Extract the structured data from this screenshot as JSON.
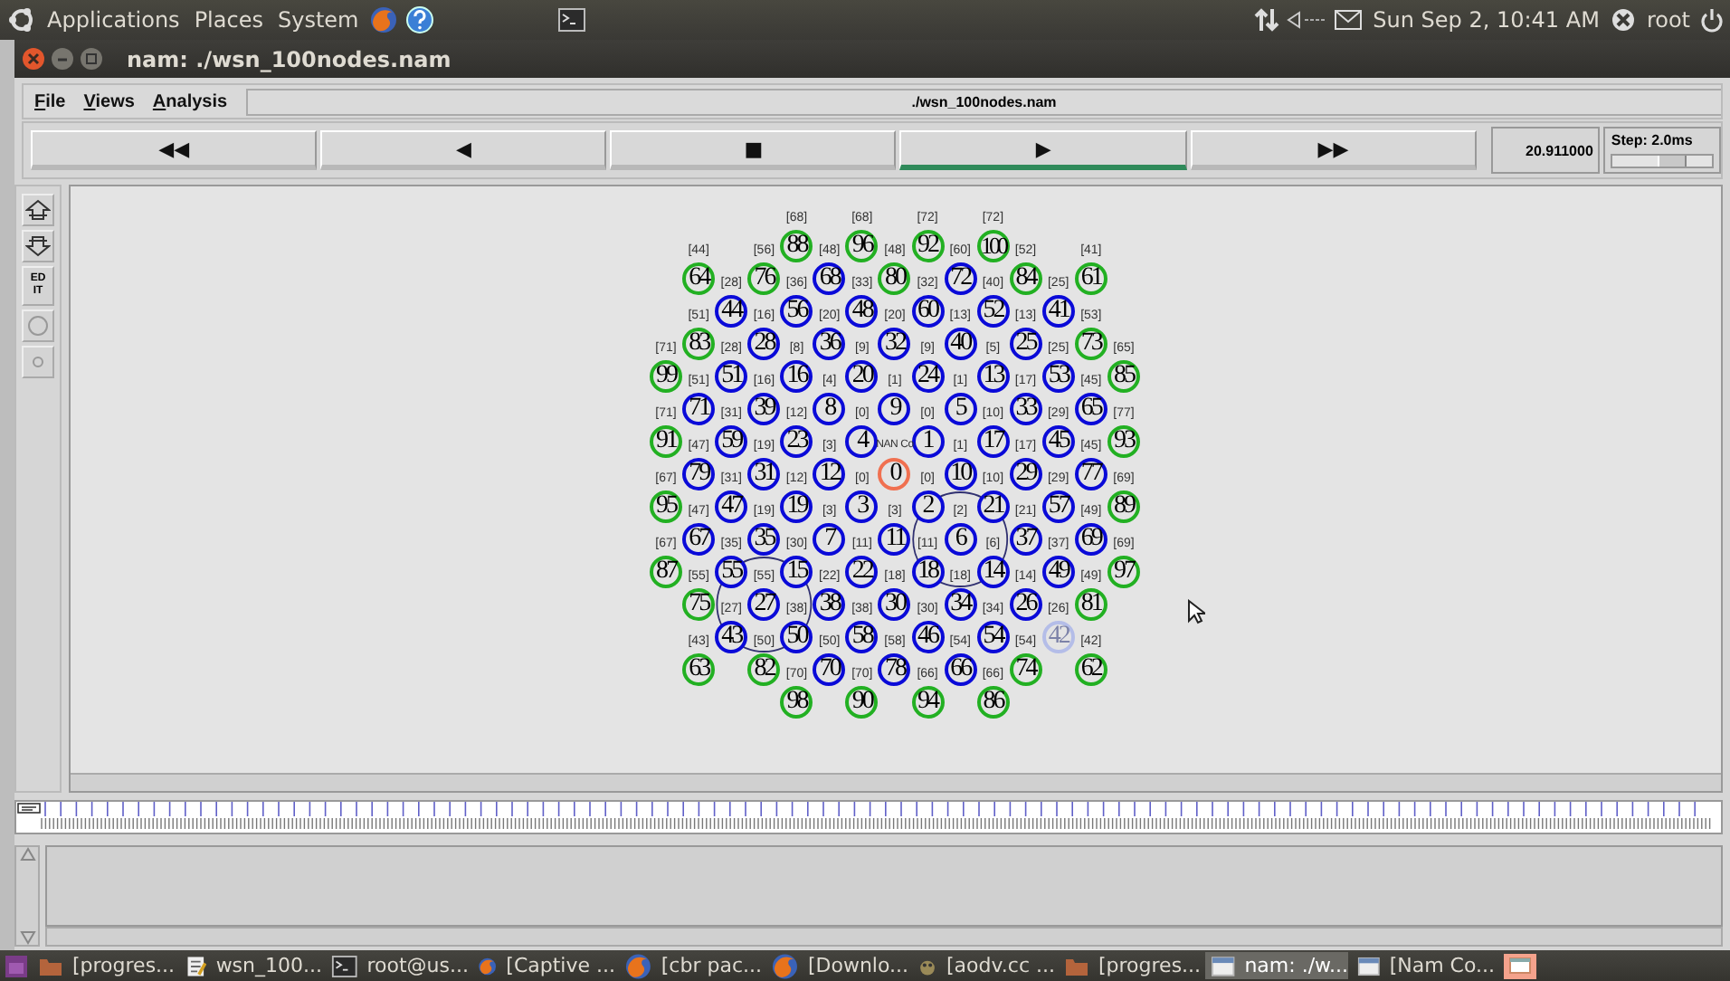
{
  "top_panel": {
    "menus": [
      "Applications",
      "Places",
      "System"
    ],
    "clock": "Sun Sep 2, 10:41 AM",
    "user": "root"
  },
  "window": {
    "title": "nam: ./wsn_100nodes.nam"
  },
  "menu": [
    "File",
    "Views",
    "Analysis"
  ],
  "file_path": "./wsn_100nodes.nam",
  "transport": [
    {
      "label": "◀◀",
      "selected": false
    },
    {
      "label": "◀",
      "selected": false
    },
    {
      "label": "■",
      "selected": false
    },
    {
      "label": "▶",
      "selected": true
    },
    {
      "label": "▶▶",
      "selected": false
    }
  ],
  "time": "20.911000",
  "step": {
    "label": "Step: 2.0ms",
    "level": 0.6
  },
  "tools": [
    {
      "kind": "zoom_in"
    },
    {
      "kind": "zoom_out"
    },
    {
      "kind": "edit",
      "label": "ED IT"
    },
    {
      "kind": "circle"
    },
    {
      "kind": "dot"
    }
  ],
  "nodes": {
    "rows": [
      [
        null,
        null,
        null,
        null,
        {
          "id": "88",
          "label": "[68]",
          "color": "#22b022",
          "kind": "plain"
        },
        null,
        {
          "id": "96",
          "label": "[68]",
          "color": "#22b022",
          "kind": "plain"
        },
        null,
        {
          "id": "92",
          "label": "[72]",
          "color": "#22b022",
          "kind": "plain"
        },
        null,
        {
          "id": "100",
          "label": "[72]",
          "color": "#22b022",
          "kind": "plain"
        },
        null,
        null,
        null,
        null
      ],
      [
        null,
        {
          "id": "64",
          "label": "[44]",
          "color": "#22b022",
          "kind": "plain"
        },
        null,
        {
          "id": "76",
          "label": "[56]",
          "color": "#22b022",
          "kind": "plain"
        },
        null,
        {
          "id": "68",
          "label": "[48]",
          "color": "#0a0ad8",
          "kind": "plain"
        },
        null,
        {
          "id": "80",
          "label": "[48]",
          "color": "#22b022",
          "kind": "plain"
        },
        null,
        {
          "id": "72",
          "label": "[60]",
          "color": "#0a0ad8",
          "kind": "plain"
        },
        null,
        {
          "id": "84",
          "label": "[52]",
          "color": "#22b022",
          "kind": "plain"
        },
        null,
        {
          "id": "61",
          "label": "[41]",
          "color": "#22b022",
          "kind": "plain"
        },
        null
      ],
      [
        null,
        null,
        {
          "id": "44",
          "label": "[28]",
          "color": "#0a0ad8",
          "kind": "plain"
        },
        null,
        {
          "id": "56",
          "label": "[36]",
          "color": "#0a0ad8",
          "kind": "plain"
        },
        null,
        {
          "id": "48",
          "label": "[33]",
          "color": "#0a0ad8",
          "kind": "plain"
        },
        null,
        {
          "id": "60",
          "label": "[32]",
          "color": "#0a0ad8",
          "kind": "plain"
        },
        null,
        {
          "id": "52",
          "label": "[40]",
          "color": "#0a0ad8",
          "kind": "plain"
        },
        null,
        {
          "id": "41",
          "label": "[25]",
          "color": "#0a0ad8",
          "kind": "plain"
        },
        null,
        null
      ],
      [
        null,
        {
          "id": "83",
          "label": "[51]",
          "color": "#22b022",
          "kind": "plain"
        },
        null,
        {
          "id": "28",
          "label": "[16]",
          "color": "#0a0ad8",
          "kind": "plain"
        },
        null,
        {
          "id": "36",
          "label": "[20]",
          "color": "#0a0ad8",
          "kind": "plain"
        },
        null,
        {
          "id": "32",
          "label": "[20]",
          "color": "#0a0ad8",
          "kind": "plain"
        },
        null,
        {
          "id": "40",
          "label": "[13]",
          "color": "#0a0ad8",
          "kind": "plain"
        },
        null,
        {
          "id": "25",
          "label": "[13]",
          "color": "#0a0ad8",
          "kind": "plain"
        },
        null,
        {
          "id": "73",
          "label": "[53]",
          "color": "#22b022",
          "kind": "plain"
        },
        null
      ],
      [
        {
          "id": "99",
          "label": "[71]",
          "color": "#22b022",
          "kind": "plain"
        },
        null,
        {
          "id": "51",
          "label": "[28]",
          "color": "#0a0ad8",
          "kind": "plain"
        },
        null,
        {
          "id": "16",
          "label": "[8]",
          "color": "#0a0ad8",
          "kind": "plain"
        },
        null,
        {
          "id": "20",
          "label": "[9]",
          "color": "#0a0ad8",
          "kind": "plain"
        },
        null,
        {
          "id": "24",
          "label": "[9]",
          "color": "#0a0ad8",
          "kind": "plain"
        },
        null,
        {
          "id": "13",
          "label": "[5]",
          "color": "#0a0ad8",
          "kind": "plain"
        },
        null,
        {
          "id": "53",
          "label": "[25]",
          "color": "#0a0ad8",
          "kind": "plain"
        },
        null,
        {
          "id": "85",
          "label": "[65]",
          "color": "#22b022",
          "kind": "plain"
        }
      ],
      [
        null,
        {
          "id": "71",
          "label": "[51]",
          "color": "#0a0ad8",
          "kind": "plain"
        },
        null,
        {
          "id": "39",
          "label": "[16]",
          "color": "#0a0ad8",
          "kind": "plain"
        },
        null,
        {
          "id": "8",
          "label": "[4]",
          "color": "#0a0ad8",
          "kind": "plain"
        },
        null,
        {
          "id": "9",
          "label": "[1]",
          "color": "#0a0ad8",
          "kind": "plain"
        },
        null,
        {
          "id": "5",
          "label": "[1]",
          "color": "#0a0ad8",
          "kind": "plain"
        },
        null,
        {
          "id": "33",
          "label": "[17]",
          "color": "#0a0ad8",
          "kind": "plain"
        },
        null,
        {
          "id": "65",
          "label": "[45]",
          "color": "#0a0ad8",
          "kind": "plain"
        },
        null
      ],
      [
        {
          "id": "91",
          "label": "[71]",
          "color": "#22b022",
          "kind": "plain"
        },
        null,
        {
          "id": "59",
          "label": "[31]",
          "color": "#0a0ad8",
          "kind": "plain"
        },
        null,
        {
          "id": "23",
          "label": "[12]",
          "color": "#0a0ad8",
          "kind": "plain"
        },
        null,
        {
          "id": "4",
          "label": "[0]",
          "color": "#0a0ad8",
          "kind": "plain"
        },
        null,
        {
          "id": "1",
          "label": "[0]",
          "color": "#0a0ad8",
          "kind": "plain"
        },
        null,
        {
          "id": "17",
          "label": "[10]",
          "color": "#0a0ad8",
          "kind": "plain"
        },
        null,
        {
          "id": "45",
          "label": "[29]",
          "color": "#0a0ad8",
          "kind": "plain"
        },
        null,
        {
          "id": "93",
          "label": "[77]",
          "color": "#22b022",
          "kind": "plain"
        }
      ],
      [
        null,
        {
          "id": "79",
          "label": "[47]",
          "color": "#0a0ad8",
          "kind": "plain"
        },
        null,
        {
          "id": "31",
          "label": "[19]",
          "color": "#0a0ad8",
          "kind": "plain"
        },
        null,
        {
          "id": "12",
          "label": "[3]",
          "color": "#0a0ad8",
          "kind": "plain"
        },
        null,
        {
          "id": "0",
          "label": "NAN Co",
          "color": "#f07050",
          "kind": "plain"
        },
        null,
        {
          "id": "10",
          "label": "[1]",
          "color": "#0a0ad8",
          "kind": "plain"
        },
        null,
        {
          "id": "29",
          "label": "[17]",
          "color": "#0a0ad8",
          "kind": "plain"
        },
        null,
        {
          "id": "77",
          "label": "[45]",
          "color": "#0a0ad8",
          "kind": "plain"
        },
        null
      ],
      [
        {
          "id": "95",
          "label": "[67]",
          "color": "#22b022",
          "kind": "plain"
        },
        null,
        {
          "id": "47",
          "label": "[31]",
          "color": "#0a0ad8",
          "kind": "plain"
        },
        null,
        {
          "id": "19",
          "label": "[12]",
          "color": "#0a0ad8",
          "kind": "plain"
        },
        null,
        {
          "id": "3",
          "label": "[0]",
          "color": "#0a0ad8",
          "kind": "plain"
        },
        null,
        {
          "id": "2",
          "label": "[0]",
          "color": "#0a0ad8",
          "kind": "plain"
        },
        null,
        {
          "id": "21",
          "label": "[10]",
          "color": "#0a0ad8",
          "kind": "plain"
        },
        null,
        {
          "id": "57",
          "label": "[29]",
          "color": "#0a0ad8",
          "kind": "plain"
        },
        null,
        {
          "id": "89",
          "label": "[69]",
          "color": "#22b022",
          "kind": "plain"
        }
      ],
      [
        null,
        {
          "id": "67",
          "label": "[47]",
          "color": "#0a0ad8",
          "kind": "plain"
        },
        null,
        {
          "id": "35",
          "label": "[19]",
          "color": "#0a0ad8",
          "kind": "plain"
        },
        null,
        {
          "id": "7",
          "label": "[3]",
          "color": "#0a0ad8",
          "kind": "plain"
        },
        null,
        {
          "id": "11",
          "label": "[3]",
          "color": "#0a0ad8",
          "kind": "plain"
        },
        null,
        {
          "id": "6",
          "label": "[2]",
          "color": "#0a0ad8",
          "kind": "ranged"
        },
        null,
        {
          "id": "37",
          "label": "[21]",
          "color": "#0a0ad8",
          "kind": "plain"
        },
        null,
        {
          "id": "69",
          "label": "[49]",
          "color": "#0a0ad8",
          "kind": "plain"
        },
        null
      ],
      [
        {
          "id": "87",
          "label": "[67]",
          "color": "#22b022",
          "kind": "plain"
        },
        null,
        {
          "id": "55",
          "label": "[35]",
          "color": "#0a0ad8",
          "kind": "plain"
        },
        null,
        {
          "id": "15",
          "label": "[30]",
          "color": "#0a0ad8",
          "kind": "plain"
        },
        null,
        {
          "id": "22",
          "label": "[11]",
          "color": "#0a0ad8",
          "kind": "plain"
        },
        null,
        {
          "id": "18",
          "label": "[11]",
          "color": "#0a0ad8",
          "kind": "plain"
        },
        null,
        {
          "id": "14",
          "label": "[6]",
          "color": "#0a0ad8",
          "kind": "plain"
        },
        null,
        {
          "id": "49",
          "label": "[37]",
          "color": "#0a0ad8",
          "kind": "plain"
        },
        null,
        {
          "id": "97",
          "label": "[69]",
          "color": "#22b022",
          "kind": "plain"
        }
      ],
      [
        null,
        {
          "id": "75",
          "label": "[55]",
          "color": "#22b022",
          "kind": "plain"
        },
        null,
        {
          "id": "27",
          "label": "[55]",
          "color": "#0a0ad8",
          "kind": "ranged"
        },
        null,
        {
          "id": "38",
          "label": "[22]",
          "color": "#0a0ad8",
          "kind": "plain"
        },
        null,
        {
          "id": "30",
          "label": "[18]",
          "color": "#0a0ad8",
          "kind": "plain"
        },
        null,
        {
          "id": "34",
          "label": "[18]",
          "color": "#0a0ad8",
          "kind": "plain"
        },
        null,
        {
          "id": "26",
          "label": "[14]",
          "color": "#0a0ad8",
          "kind": "plain"
        },
        null,
        {
          "id": "81",
          "label": "[49]",
          "color": "#22b022",
          "kind": "plain"
        },
        null
      ],
      [
        null,
        null,
        {
          "id": "43",
          "label": "[27]",
          "color": "#0a0ad8",
          "kind": "plain"
        },
        null,
        {
          "id": "50",
          "label": "[38]",
          "color": "#0a0ad8",
          "kind": "plain"
        },
        null,
        {
          "id": "58",
          "label": "[38]",
          "color": "#0a0ad8",
          "kind": "plain"
        },
        null,
        {
          "id": "46",
          "label": "[30]",
          "color": "#0a0ad8",
          "kind": "plain"
        },
        null,
        {
          "id": "54",
          "label": "[34]",
          "color": "#0a0ad8",
          "kind": "plain"
        },
        null,
        {
          "id": "42",
          "label": "[26]",
          "color": "#b4bde8",
          "kind": "dimmed"
        },
        null,
        null
      ],
      [
        null,
        {
          "id": "63",
          "label": "[43]",
          "color": "#22b022",
          "kind": "plain"
        },
        null,
        {
          "id": "82",
          "label": "[50]",
          "color": "#22b022",
          "kind": "plain"
        },
        null,
        {
          "id": "70",
          "label": "[50]",
          "color": "#0a0ad8",
          "kind": "plain"
        },
        null,
        {
          "id": "78",
          "label": "[58]",
          "color": "#0a0ad8",
          "kind": "plain"
        },
        null,
        {
          "id": "66",
          "label": "[54]",
          "color": "#0a0ad8",
          "kind": "plain"
        },
        null,
        {
          "id": "74",
          "label": "[54]",
          "color": "#22b022",
          "kind": "plain"
        },
        null,
        {
          "id": "62",
          "label": "[42]",
          "color": "#22b022",
          "kind": "plain"
        },
        null
      ],
      [
        null,
        null,
        null,
        null,
        {
          "id": "98",
          "label": "[70]",
          "color": "#22b022",
          "kind": "plain"
        },
        null,
        {
          "id": "90",
          "label": "[70]",
          "color": "#22b022",
          "kind": "plain"
        },
        null,
        {
          "id": "94",
          "label": "[66]",
          "color": "#22b022",
          "kind": "plain"
        },
        null,
        {
          "id": "86",
          "label": "[66]",
          "color": "#22b022",
          "kind": "plain"
        },
        null,
        null,
        null,
        null
      ]
    ]
  },
  "taskbar": [
    {
      "label": "[progres...",
      "kind": "folder",
      "selected": false
    },
    {
      "label": "wsn_100...",
      "kind": "editor",
      "selected": false
    },
    {
      "label": "root@us...",
      "kind": "terminal",
      "selected": false
    },
    {
      "label": "[Captive ...",
      "kind": "browser",
      "selected": false
    },
    {
      "label": "[cbr pac...",
      "kind": "browser",
      "selected": false
    },
    {
      "label": "[Downlo...",
      "kind": "browser",
      "selected": false
    },
    {
      "label": "[aodv.cc ...",
      "kind": "paint",
      "selected": false
    },
    {
      "label": "[progres...",
      "kind": "folder",
      "selected": false
    },
    {
      "label": "nam: ./w...",
      "kind": "window",
      "selected": true
    },
    {
      "label": "[Nam Co...",
      "kind": "window",
      "selected": false
    }
  ]
}
